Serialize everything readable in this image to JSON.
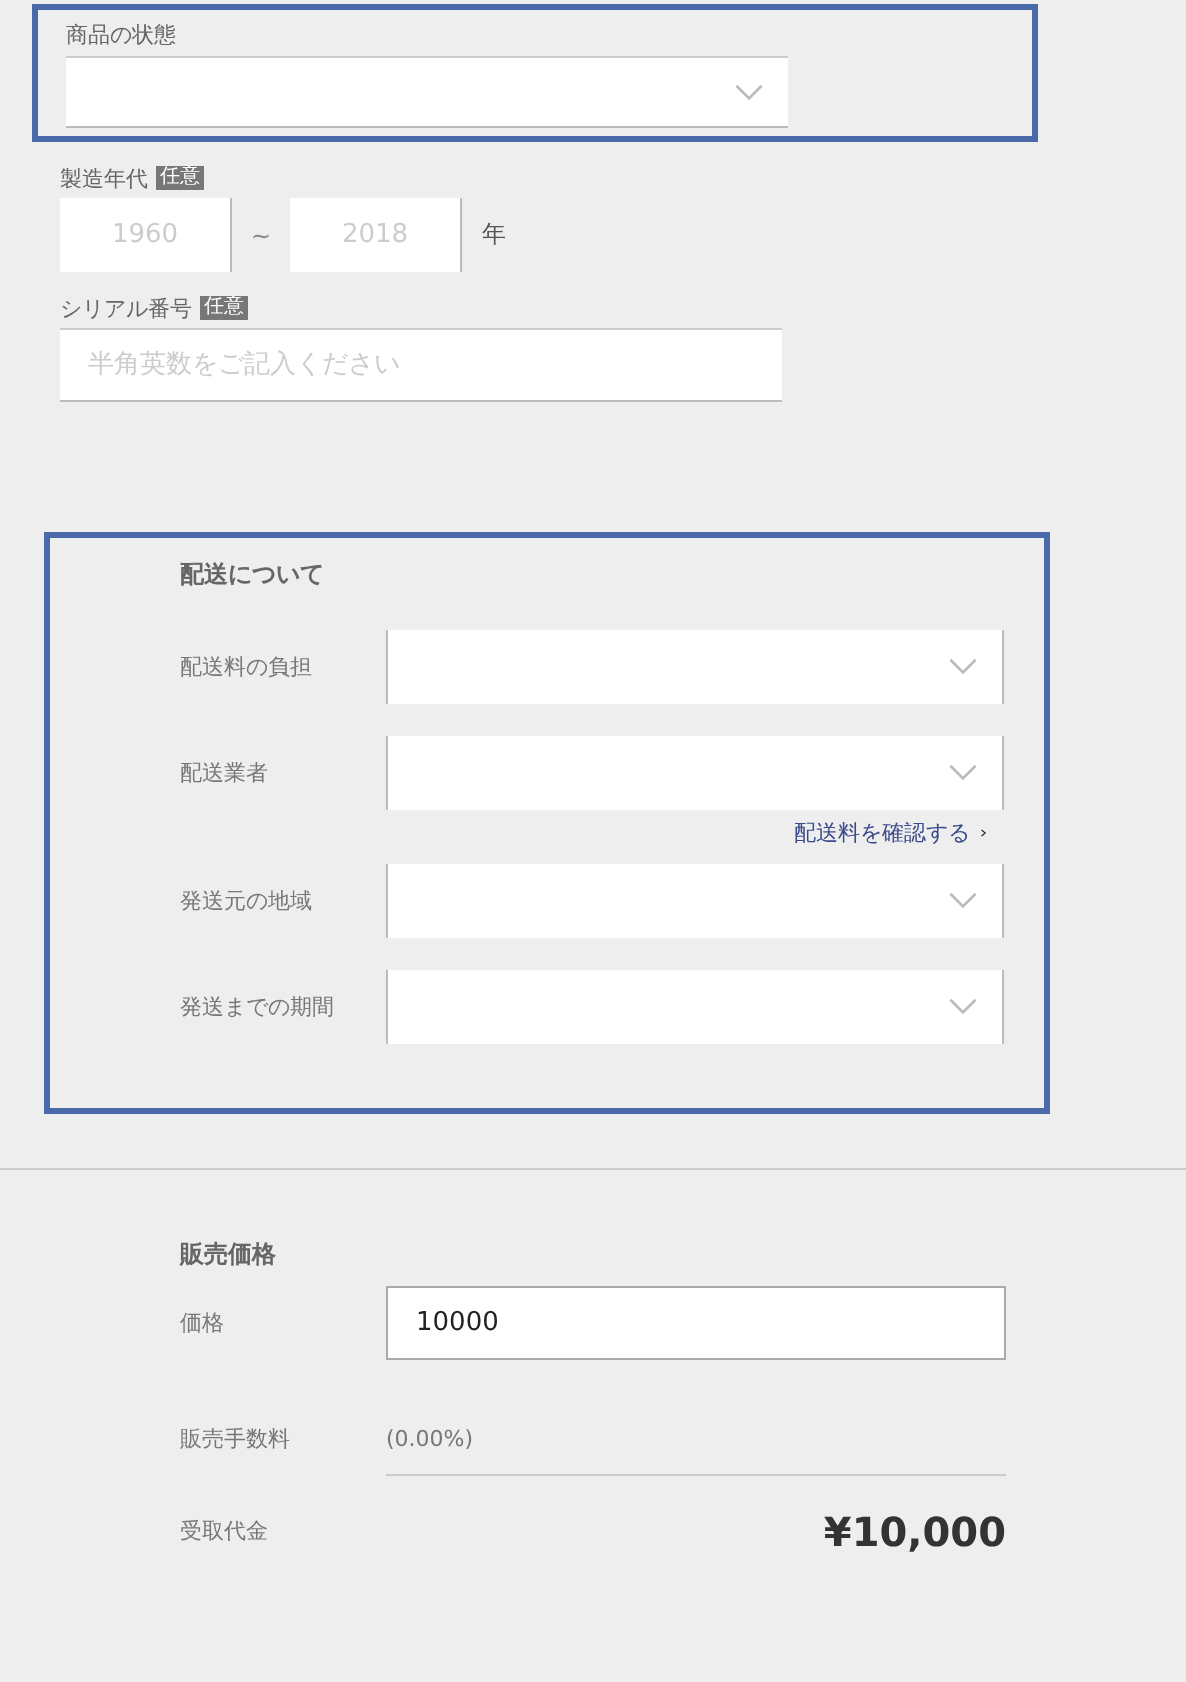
{
  "condition": {
    "label": "商品の状態",
    "highlighted": true
  },
  "manufacture_years": {
    "label": "製造年代",
    "badge": "任意",
    "from": {
      "placeholder": "1960"
    },
    "separator": "~",
    "to": {
      "placeholder": "2018"
    },
    "unit": "年"
  },
  "serial_number": {
    "label": "シリアル番号",
    "badge": "任意",
    "placeholder": "半角英数をご記入ください"
  },
  "shipping": {
    "title": "配送について",
    "highlighted": true,
    "fields": [
      {
        "label": "配送料の負担"
      },
      {
        "label": "配送業者",
        "link": "配送料を確認する"
      },
      {
        "label": "発送元の地域"
      },
      {
        "label": "発送までの期間"
      }
    ]
  },
  "pricing": {
    "title": "販売価格",
    "price": {
      "label": "価格",
      "value": "10000"
    },
    "fee": {
      "label": "販売手数料",
      "value": "(0.00%)"
    },
    "proceeds": {
      "label": "受取代金",
      "value": "¥10,000"
    }
  }
}
